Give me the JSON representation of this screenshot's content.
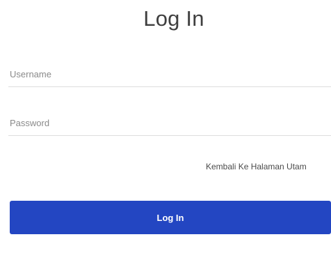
{
  "title": "Log In",
  "username": {
    "placeholder": "Username",
    "value": ""
  },
  "password": {
    "placeholder": "Password",
    "value": ""
  },
  "back_link": "Kembali Ke Halaman Utam",
  "login_button": "Log In",
  "colors": {
    "button_background": "#2346c2",
    "button_text": "#ffffff",
    "title_text": "#3f3f3f"
  }
}
